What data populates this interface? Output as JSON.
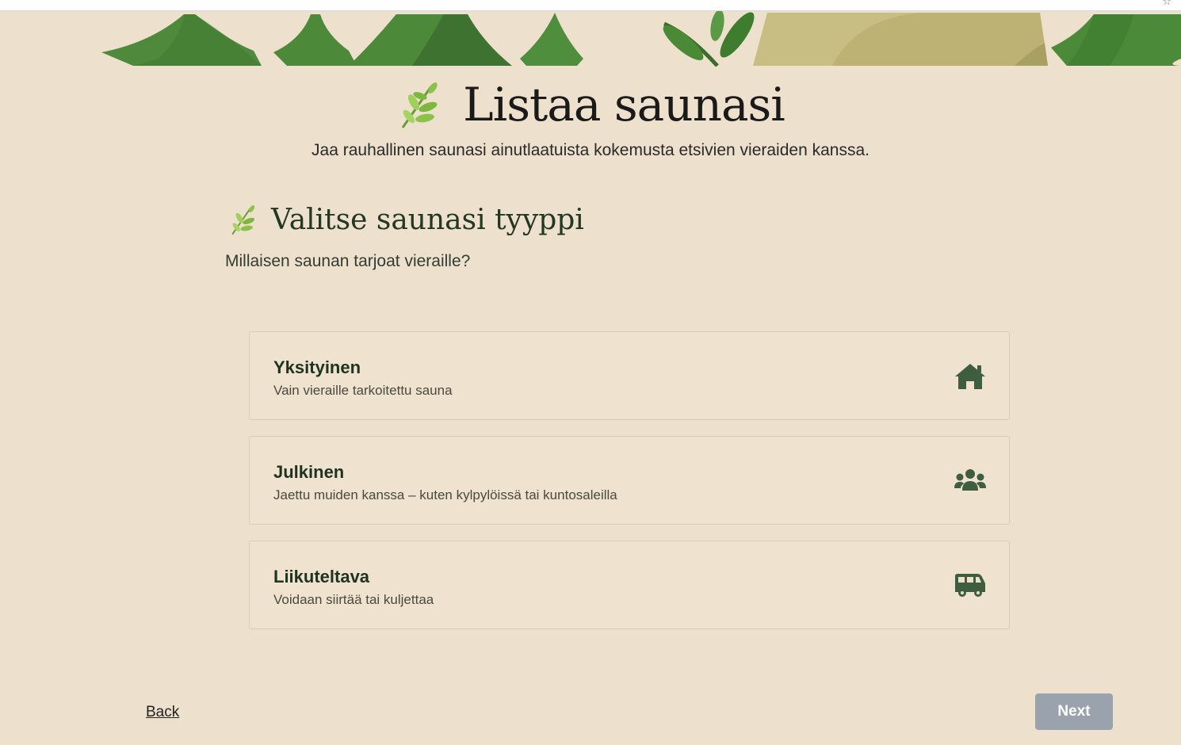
{
  "hero": {
    "title": "Listaa saunasi",
    "subtitle": "Jaa rauhallinen saunasi ainutlaatuista kokemusta etsivien vieraiden kanssa.",
    "icon": "leaf-sprig-icon"
  },
  "section": {
    "title": "Valitse saunasi tyyppi",
    "subtitle": "Millaisen saunan tarjoat vieraille?",
    "icon": "leaf-sprig-icon"
  },
  "options": [
    {
      "title": "Yksityinen",
      "description": "Vain vieraille tarkoitettu sauna",
      "icon": "home-icon"
    },
    {
      "title": "Julkinen",
      "description": "Jaettu muiden kanssa – kuten kylpylöissä tai kuntosaleilla",
      "icon": "users-icon"
    },
    {
      "title": "Liikuteltava",
      "description": "Voidaan siirtää tai kuljettaa",
      "icon": "van-icon"
    }
  ],
  "nav": {
    "back_label": "Back",
    "next_label": "Next"
  },
  "colors": {
    "background": "#ede0cc",
    "accent_green": "#3f5e3f",
    "next_disabled": "#9aa3ad"
  }
}
